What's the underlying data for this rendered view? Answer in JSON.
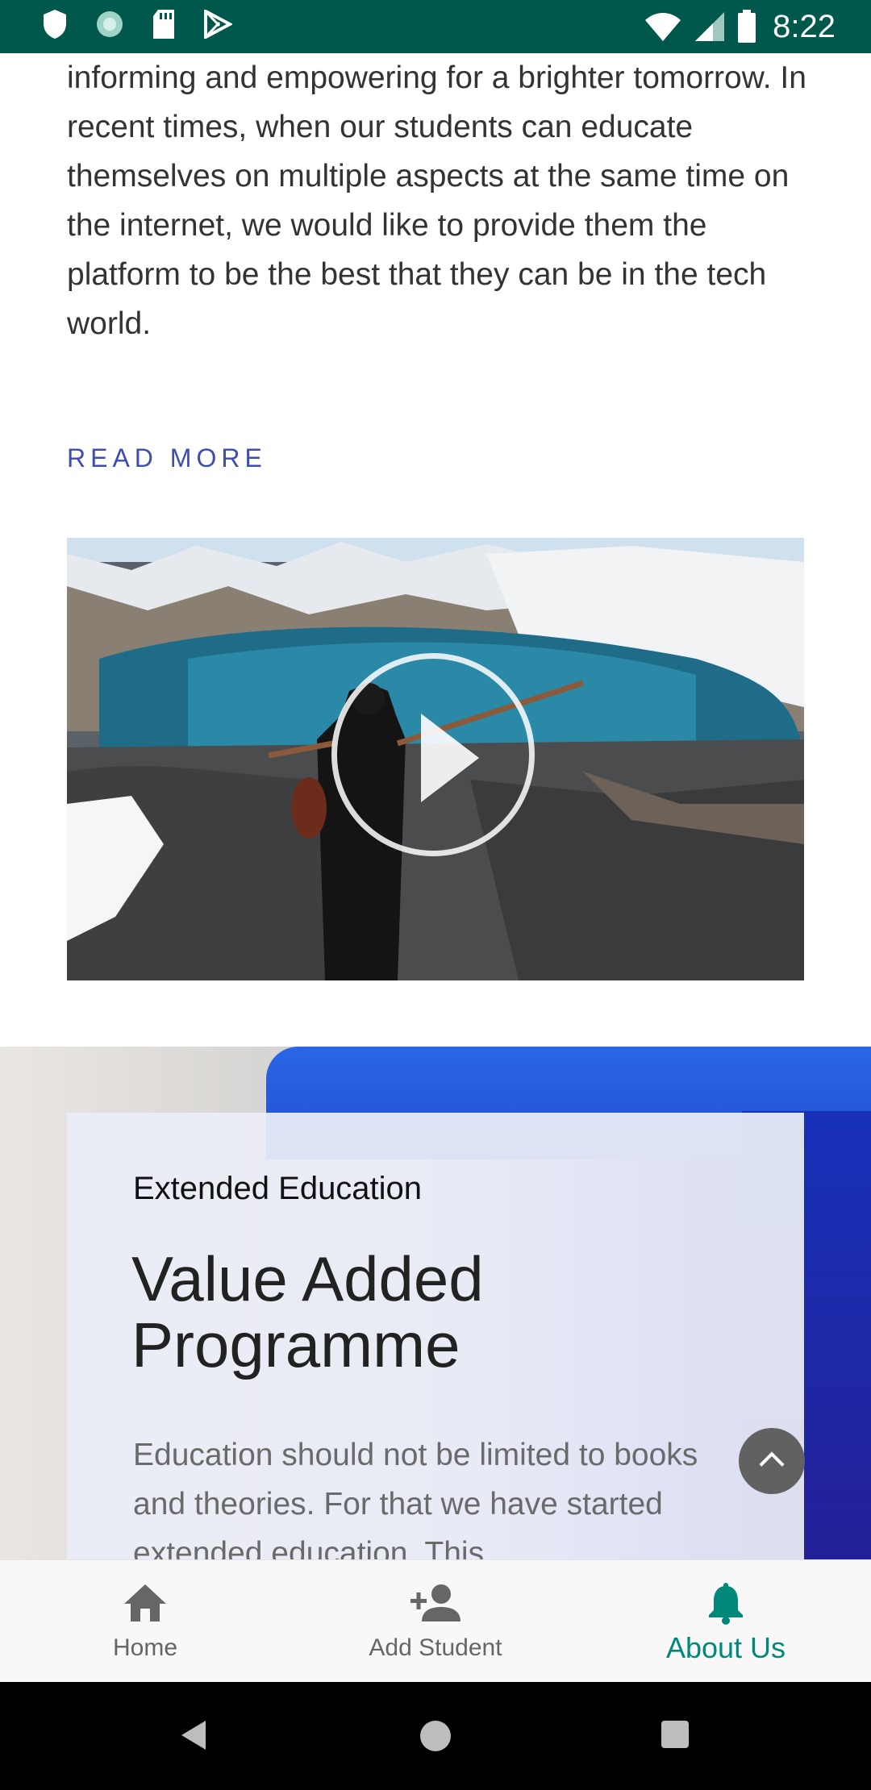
{
  "status_bar": {
    "time": "8:22",
    "icons_left": [
      "shield-icon",
      "sync-icon",
      "sd-card-icon",
      "play-store-icon"
    ],
    "icons_right": [
      "wifi-icon",
      "cell-signal-icon",
      "battery-icon"
    ],
    "background": "#00574b"
  },
  "intro": {
    "text": "informing and empowering for a brighter tomorrow. In recent times, when our students can educate themselves on multiple aspects at the same time on the internet, we would like to provide them the platform to be the best that they can be in the tech world."
  },
  "read_more_label": "READ MORE",
  "video": {
    "thumbnail": "woman-with-violin-by-mountain-lake",
    "play_icon": "play-icon"
  },
  "extended_education": {
    "label": "Extended Education",
    "title": "Value Added Programme",
    "description": "Education should not be limited to books and theories. For that we have started extended education. This"
  },
  "scroll_top_icon": "chevron-up-icon",
  "bottom_nav": {
    "items": [
      {
        "label": "Home",
        "icon": "home-icon"
      },
      {
        "label": "Add Student",
        "icon": "add-person-icon"
      },
      {
        "label": "About Us",
        "icon": "bell-icon"
      }
    ],
    "active_color": "#00897b"
  }
}
